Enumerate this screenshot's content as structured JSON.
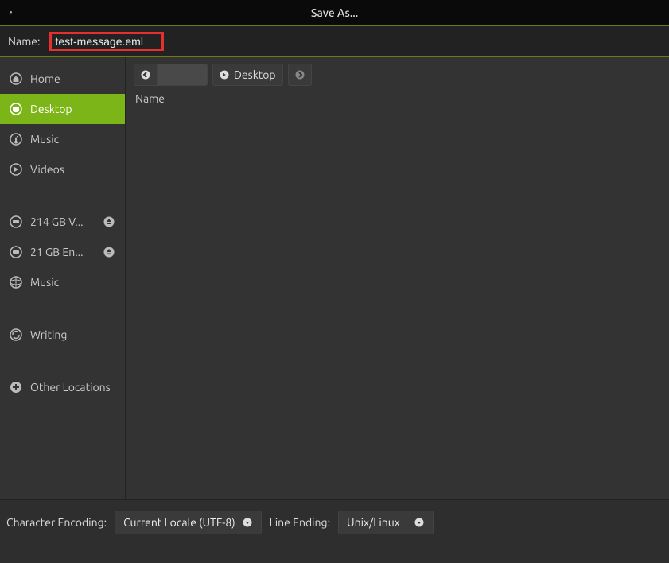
{
  "window": {
    "title": "Save As..."
  },
  "name_field": {
    "label": "Name:",
    "value": "test-message.eml"
  },
  "sidebar": {
    "items": [
      {
        "label": "Home",
        "icon": "home-icon",
        "eject": false
      },
      {
        "label": "Desktop",
        "icon": "desktop-icon",
        "eject": false,
        "selected": true
      },
      {
        "label": "Music",
        "icon": "music-icon",
        "eject": false
      },
      {
        "label": "Videos",
        "icon": "videos-icon",
        "eject": false
      },
      {
        "label": "214 GB V...",
        "icon": "drive-icon",
        "eject": true
      },
      {
        "label": "21 GB En...",
        "icon": "drive-icon",
        "eject": true
      },
      {
        "label": "Music",
        "icon": "network-icon",
        "eject": false
      },
      {
        "label": "Writing",
        "icon": "sync-icon",
        "eject": false
      },
      {
        "label": "Other Locations",
        "icon": "plus-icon",
        "eject": false
      }
    ]
  },
  "pathbar": {
    "crumb": "Desktop"
  },
  "list": {
    "header": "Name"
  },
  "encoding": {
    "label": "Character Encoding:",
    "value": "Current Locale (UTF-8)"
  },
  "line_ending": {
    "label": "Line Ending:",
    "value": "Unix/Linux"
  }
}
